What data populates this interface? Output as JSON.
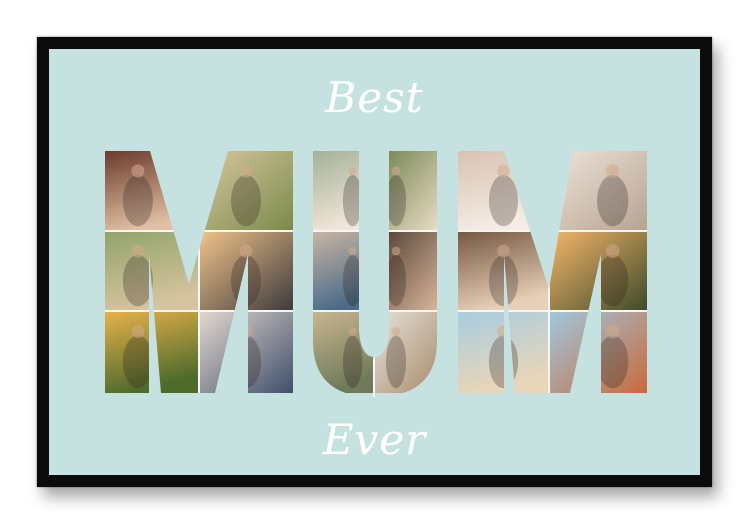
{
  "watermark": "",
  "poster": {
    "top_text": "Best",
    "main_word": "MUM",
    "bottom_text": "Ever"
  },
  "colors": {
    "frame": "#0b0b0b",
    "mat": "#c6e2e0",
    "lettering": "#ffffff"
  },
  "photos": [
    {
      "name": "mother-daughter-kiss-photo",
      "palette": [
        "#6b3b2c",
        "#e2c0a4"
      ]
    },
    {
      "name": "family-walk-field-photo",
      "palette": [
        "#d9c8a2",
        "#7a8a4a"
      ]
    },
    {
      "name": "mother-child-hug-photo",
      "palette": [
        "#a3b19a",
        "#f1e6d8"
      ]
    },
    {
      "name": "outdoor-family-photo",
      "palette": [
        "#6c7f4b",
        "#e9dcc4"
      ]
    },
    {
      "name": "baby-feet-photo",
      "palette": [
        "#d8c2b2",
        "#f5ede4"
      ]
    },
    {
      "name": "hands-holding-photo",
      "palette": [
        "#efe4da",
        "#b6a391"
      ]
    },
    {
      "name": "child-meadow-photo",
      "palette": [
        "#91a469",
        "#d6c3a0"
      ]
    },
    {
      "name": "beach-sunset-photo",
      "palette": [
        "#f2c48a",
        "#3c3a3d"
      ]
    },
    {
      "name": "child-on-beach-photo",
      "palette": [
        "#c9b6a2",
        "#4a6b8a"
      ]
    },
    {
      "name": "mother-son-selfie-photo",
      "palette": [
        "#4a3a2e",
        "#d9b59a"
      ]
    },
    {
      "name": "mother-daughter-smile-photo",
      "palette": [
        "#74573f",
        "#e8cfb8"
      ]
    },
    {
      "name": "sunset-family-silhouette-photo",
      "palette": [
        "#f6b76a",
        "#3e4a2a"
      ]
    },
    {
      "name": "sunflower-field-photo",
      "palette": [
        "#e8b24a",
        "#4d6a2b"
      ]
    },
    {
      "name": "family-on-sofa-photo",
      "palette": [
        "#e4d9cf",
        "#3f4f6b"
      ]
    },
    {
      "name": "field-portrait-photo",
      "palette": [
        "#c9b690",
        "#6f7a5a"
      ]
    },
    {
      "name": "child-jump-photo",
      "palette": [
        "#e7e4dd",
        "#a88c6c"
      ]
    },
    {
      "name": "beach-lift-photo",
      "palette": [
        "#a8cde0",
        "#e9d6b8"
      ]
    },
    {
      "name": "beach-sitting-photo",
      "palette": [
        "#9fc8e0",
        "#c96a3a"
      ]
    },
    {
      "name": "family-standing-photo",
      "palette": [
        "#7c8f5a",
        "#cfc4b4"
      ]
    }
  ]
}
